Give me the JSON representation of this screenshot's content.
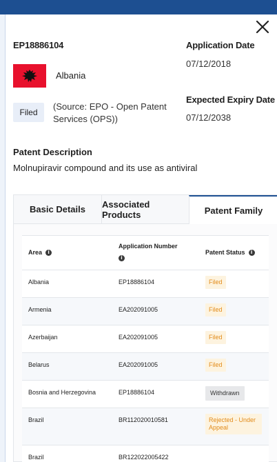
{
  "header": {
    "patent_id": "EP18886104",
    "country": "Albania",
    "status": "Filed",
    "source": "(Source: EPO - Open Patent Services (OPS))",
    "application_date_label": "Application Date",
    "application_date": "07/12/2018",
    "expiry_date_label": "Expected Expiry Date",
    "expiry_date": "07/12/2038"
  },
  "description": {
    "title": "Patent Description",
    "text": "Molnupiravir compound and its use as antiviral"
  },
  "tabs": [
    {
      "label": "Basic Details"
    },
    {
      "label": "Associated Products"
    },
    {
      "label": "Patent Family"
    }
  ],
  "table": {
    "headers": {
      "area": "Area",
      "application_number": "Application Number",
      "patent_status": "Patent Status"
    },
    "rows": [
      {
        "area": "Albania",
        "number": "EP18886104",
        "status": "Filed"
      },
      {
        "area": "Armenia",
        "number": "EA202091005",
        "status": "Filed"
      },
      {
        "area": "Azerbaijan",
        "number": "EA202091005",
        "status": "Filed"
      },
      {
        "area": "Belarus",
        "number": "EA202091005",
        "status": "Filed"
      },
      {
        "area": "Bosnia and Herzegovina",
        "number": "EP18886104",
        "status": "Withdrawn"
      },
      {
        "area": "Brazil",
        "number": "BR112020010581",
        "status": "Rejected - Under Appeal"
      },
      {
        "area": "Brazil",
        "number": "BR122022005422",
        "status": ""
      }
    ]
  },
  "colors": {
    "brand": "#1d4f91",
    "flag_red": "#e8112d",
    "filed_text": "#e28b1a",
    "filed_bg": "#fdf3df"
  },
  "icons": [
    "close-icon",
    "albania-flag-icon",
    "info-icon"
  ]
}
